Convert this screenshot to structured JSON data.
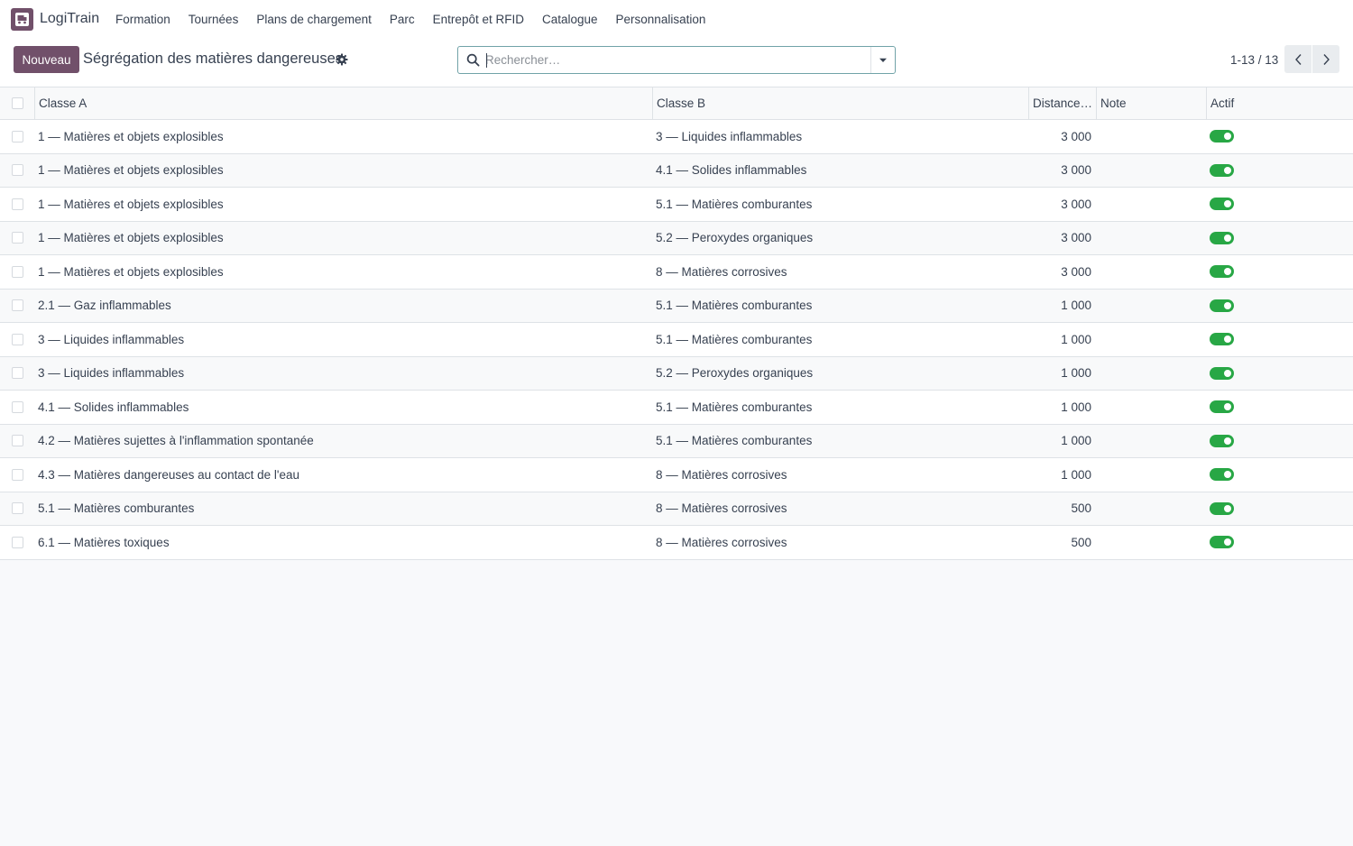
{
  "app": {
    "name": "LogiTrain"
  },
  "menu": [
    {
      "label": "Formation",
      "name": "menu-formation"
    },
    {
      "label": "Tournées",
      "name": "menu-tournees"
    },
    {
      "label": "Plans de chargement",
      "name": "menu-plans-de-chargement"
    },
    {
      "label": "Parc",
      "name": "menu-parc"
    },
    {
      "label": "Entrepôt et RFID",
      "name": "menu-entrepot-et-rfid"
    },
    {
      "label": "Catalogue",
      "name": "menu-catalogue"
    },
    {
      "label": "Personnalisation",
      "name": "menu-personnalisation"
    }
  ],
  "toolbar": {
    "new_label": "Nouveau",
    "title": "Ségrégation des matières dangereuses"
  },
  "search": {
    "placeholder": "Rechercher…",
    "value": ""
  },
  "pager": {
    "value": "1-13 / 13"
  },
  "table": {
    "headers": {
      "classe_a": "Classe A",
      "classe_b": "Classe B",
      "distance": "Distance…",
      "note": "Note",
      "actif": "Actif"
    },
    "rows": [
      {
        "classe_a": "1 — Matières et objets explosibles",
        "classe_b": "3 — Liquides inflammables",
        "distance": "3 000",
        "note": "",
        "actif": true
      },
      {
        "classe_a": "1 — Matières et objets explosibles",
        "classe_b": "4.1 — Solides inflammables",
        "distance": "3 000",
        "note": "",
        "actif": true
      },
      {
        "classe_a": "1 — Matières et objets explosibles",
        "classe_b": "5.1 — Matières comburantes",
        "distance": "3 000",
        "note": "",
        "actif": true
      },
      {
        "classe_a": "1 — Matières et objets explosibles",
        "classe_b": "5.2 — Peroxydes organiques",
        "distance": "3 000",
        "note": "",
        "actif": true
      },
      {
        "classe_a": "1 — Matières et objets explosibles",
        "classe_b": "8 — Matières corrosives",
        "distance": "3 000",
        "note": "",
        "actif": true
      },
      {
        "classe_a": "2.1 — Gaz inflammables",
        "classe_b": "5.1 — Matières comburantes",
        "distance": "1 000",
        "note": "",
        "actif": true
      },
      {
        "classe_a": "3 — Liquides inflammables",
        "classe_b": "5.1 — Matières comburantes",
        "distance": "1 000",
        "note": "",
        "actif": true
      },
      {
        "classe_a": "3 — Liquides inflammables",
        "classe_b": "5.2 — Peroxydes organiques",
        "distance": "1 000",
        "note": "",
        "actif": true
      },
      {
        "classe_a": "4.1 — Solides inflammables",
        "classe_b": "5.1 — Matières comburantes",
        "distance": "1 000",
        "note": "",
        "actif": true
      },
      {
        "classe_a": "4.2 — Matières sujettes à l'inflammation spontanée",
        "classe_b": "5.1 — Matières comburantes",
        "distance": "1 000",
        "note": "",
        "actif": true
      },
      {
        "classe_a": "4.3 — Matières dangereuses au contact de l'eau",
        "classe_b": "8 — Matières corrosives",
        "distance": "1 000",
        "note": "",
        "actif": true
      },
      {
        "classe_a": "5.1 — Matières comburantes",
        "classe_b": "8 — Matières corrosives",
        "distance": "500",
        "note": "",
        "actif": true
      },
      {
        "classe_a": "6.1 — Matières toxiques",
        "classe_b": "8 — Matières corrosives",
        "distance": "500",
        "note": "",
        "actif": true
      }
    ]
  },
  "colors": {
    "brand": "#71506a",
    "toggle_on": "#28a745",
    "search_border": "#71a3a8"
  },
  "icons": {
    "logo": "truck-app-icon",
    "settings": "gear-icon",
    "search": "search-icon",
    "search_toggle": "caret-down-icon",
    "pager_prev": "chevron-left-icon",
    "pager_next": "chevron-right-icon"
  }
}
